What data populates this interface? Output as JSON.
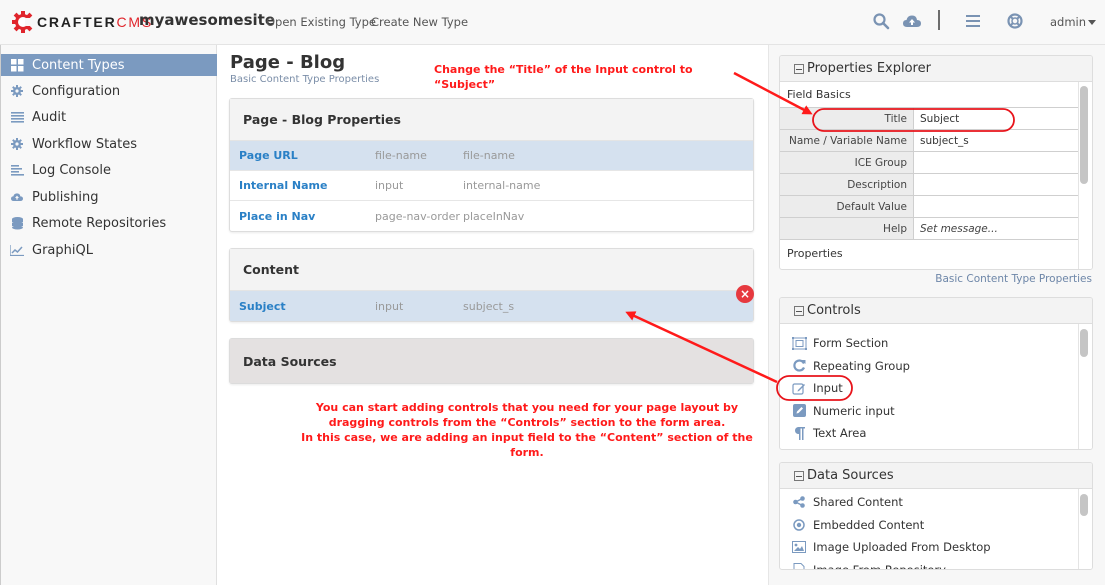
{
  "header": {
    "logo_craft": "CRAFTER",
    "logo_cms": "CMS",
    "site_name": "myawesomesite",
    "nav": [
      "Open Existing Type",
      "Create New Type"
    ],
    "icons": [
      "search-icon",
      "cloud-upload-icon",
      "menu-icon",
      "help-lifebuoy-icon"
    ],
    "user": "admin"
  },
  "sidebar": {
    "items": [
      {
        "label": "Content Types",
        "icon": "grid-icon",
        "active": true
      },
      {
        "label": "Configuration",
        "icon": "gear-icon"
      },
      {
        "label": "Audit",
        "icon": "list-icon"
      },
      {
        "label": "Workflow States",
        "icon": "gear-icon"
      },
      {
        "label": "Log Console",
        "icon": "align-left-icon"
      },
      {
        "label": "Publishing",
        "icon": "cloud-upload-icon"
      },
      {
        "label": "Remote Repositories",
        "icon": "database-icon"
      },
      {
        "label": "GraphiQL",
        "icon": "chart-line-icon"
      }
    ]
  },
  "main": {
    "title": "Page - Blog",
    "subtitle": "Basic Content Type Properties",
    "sections": [
      {
        "title": "Page - Blog Properties",
        "rows": [
          {
            "label": "Page URL",
            "type": "file-name",
            "id": "file-name",
            "selected": true
          },
          {
            "label": "Internal Name",
            "type": "input",
            "id": "internal-name"
          },
          {
            "label": "Place in Nav",
            "type": "page-nav-order",
            "id": "placeInNav"
          }
        ]
      },
      {
        "title": "Content",
        "rows": [
          {
            "label": "Subject",
            "type": "input",
            "id": "subject_s",
            "selected": true
          }
        ]
      },
      {
        "title": "Data Sources",
        "rows": []
      }
    ],
    "remove_icon": "×"
  },
  "annotations": {
    "title_hint": "Change the “Title” of the Input control to “Subject”",
    "drag_hint_1": "You can start adding controls that you need for your page layout by",
    "drag_hint_2": "dragging controls from the “Controls” section to the form area.",
    "drag_hint_3": "In this case, we are adding an input field to the “Content” section of the form."
  },
  "properties_explorer": {
    "title": "Properties Explorer",
    "field_basics": "Field Basics",
    "fields": [
      {
        "key": "Title",
        "value": "Subject"
      },
      {
        "key": "Name / Variable Name",
        "value": "subject_s",
        "help": "?"
      },
      {
        "key": "ICE Group",
        "value": ""
      },
      {
        "key": "Description",
        "value": ""
      },
      {
        "key": "Default Value",
        "value": ""
      },
      {
        "key": "Help",
        "value": "Set message..."
      }
    ],
    "properties_label": "Properties",
    "basic_link": "Basic Content Type Properties"
  },
  "controls": {
    "title": "Controls",
    "items": [
      {
        "label": "Form Section",
        "icon": "form-section-icon"
      },
      {
        "label": "Repeating Group",
        "icon": "repeat-icon"
      },
      {
        "label": "Input",
        "icon": "edit-icon"
      },
      {
        "label": "Numeric input",
        "icon": "pencil-square-icon"
      },
      {
        "label": "Text Area",
        "icon": "paragraph-icon"
      }
    ]
  },
  "data_sources": {
    "title": "Data Sources",
    "items": [
      {
        "label": "Shared Content",
        "icon": "share-icon"
      },
      {
        "label": "Embedded Content",
        "icon": "dot-circle-icon"
      },
      {
        "label": "Image Uploaded From Desktop",
        "icon": "image-icon"
      },
      {
        "label": "Image From Repository",
        "icon": "file-image-icon"
      }
    ]
  },
  "colors": {
    "accent": "#7b9ac0",
    "link": "#2a80c6",
    "annotation": "#ff1a1a",
    "selected_row": "#d5e1ef",
    "danger": "#e6393f"
  }
}
